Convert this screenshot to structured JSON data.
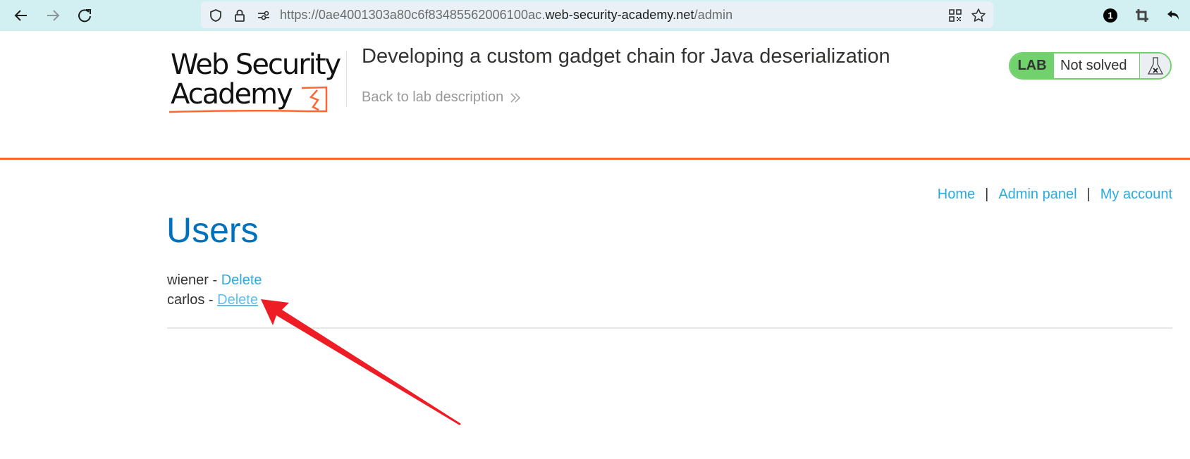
{
  "browser": {
    "url_prefix": "https://0ae4001303a80c6f83485562006100ac.",
    "url_host": "web-security-academy.net",
    "url_path": "/admin",
    "icons": {
      "back": "arrow-left-icon",
      "forward": "arrow-right-icon",
      "reload": "reload-icon",
      "shield": "shield-icon",
      "lock": "lock-icon",
      "permissions": "permissions-icon",
      "qr": "qr-code-icon",
      "bookmark": "star-icon",
      "extension_badge": "1",
      "crop": "crop-icon",
      "undo": "undo-icon"
    }
  },
  "header": {
    "logo_line1": "Web Security",
    "logo_line2": "Academy",
    "lab_title": "Developing a custom gadget chain for Java deserialization",
    "back_link": "Back to lab description",
    "lab_badge": "LAB",
    "lab_status": "Not solved",
    "brand_color": "#ff6633",
    "status_color": "#70d16d"
  },
  "nav": {
    "home": "Home",
    "separator": "|",
    "admin_panel": "Admin panel",
    "my_account": "My account"
  },
  "main": {
    "heading": "Users",
    "users": [
      {
        "name": "wiener",
        "separator": " - ",
        "action": "Delete"
      },
      {
        "name": "carlos",
        "separator": " - ",
        "action": "Delete"
      }
    ]
  },
  "annotation": {
    "color": "#ee1c25",
    "points_to": "carlos delete link"
  }
}
